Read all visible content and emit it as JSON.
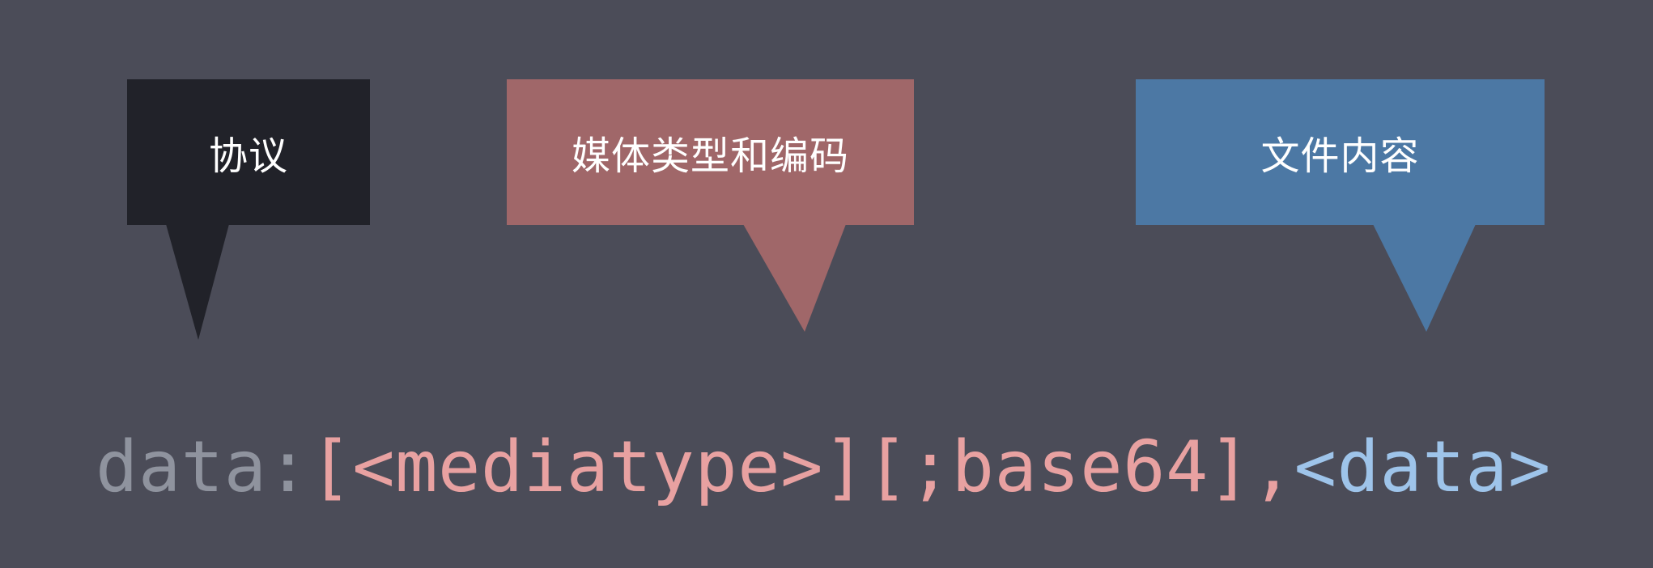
{
  "colors": {
    "background": "#4b4c58",
    "protocol_callout": "#212229",
    "mediatype_callout": "#a06769",
    "data_callout": "#4c78a4",
    "protocol_text": "#8f939e",
    "mediatype_text": "#e8a1a1",
    "data_text": "#9ec4ea"
  },
  "callouts": {
    "protocol": {
      "label": "协议"
    },
    "mediatype": {
      "label": "媒体类型和编码"
    },
    "data": {
      "label": "文件内容"
    }
  },
  "syntax": {
    "protocol": "data:",
    "mediatype_encoding": "[<mediatype>][;base64],",
    "data": "<data>"
  }
}
